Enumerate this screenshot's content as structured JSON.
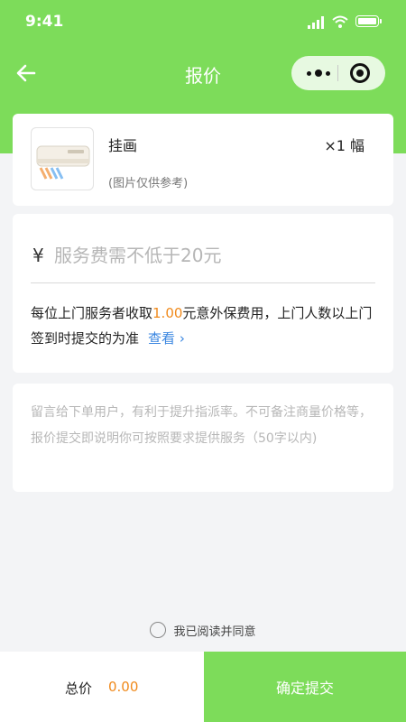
{
  "status_bar": {
    "time": "9:41"
  },
  "nav": {
    "title": "报价"
  },
  "product": {
    "name": "挂画",
    "quantity": "×1 幅",
    "image_note": "(图片仅供参考)",
    "image_icon": "air-conditioner-image"
  },
  "price": {
    "currency": "¥",
    "placeholder": "服务费需不低于20元",
    "rule_prefix": "每位上门服务者收取",
    "rule_fee": "1.00",
    "rule_suffix": "元意外保费用，上门人数以上门签到时提交的为准",
    "view_label": "查看",
    "view_arrow": "›"
  },
  "remark": {
    "placeholder": "留言给下单用户，有利于提升指派率。不可备注商量价格等，报价提交即说明你可按照要求提供服务（50字以内)"
  },
  "agreement": {
    "label": "我已阅读并同意",
    "checked": false
  },
  "footer": {
    "total_label": "总价",
    "total_value": "0.00",
    "submit_label": "确定提交"
  },
  "colors": {
    "brand": "#7ddc5a",
    "accent_orange": "#f08a1c",
    "link_blue": "#3a86e0"
  }
}
